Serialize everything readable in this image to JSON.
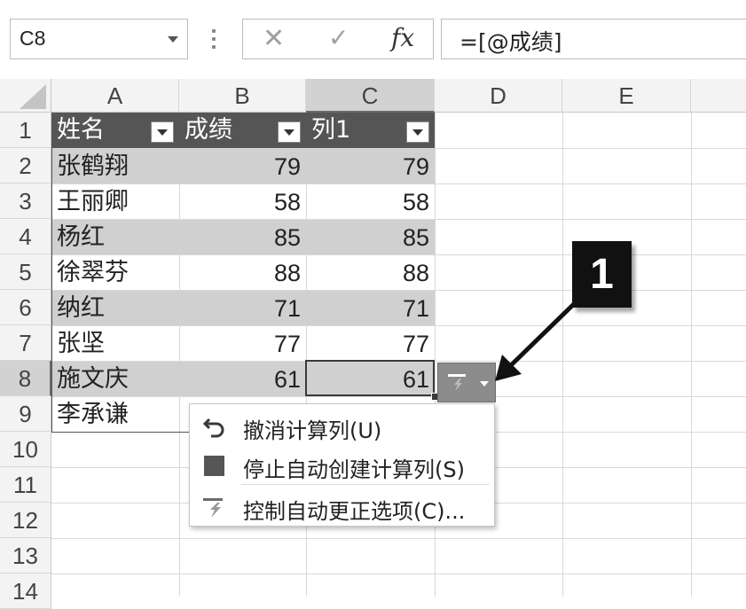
{
  "formula_bar": {
    "name_box": "C8",
    "cancel_symbol": "✕",
    "enter_symbol": "✓",
    "fx_label": "fx",
    "formula": "=[@成绩]"
  },
  "columns": [
    "A",
    "B",
    "C",
    "D",
    "E"
  ],
  "rows": [
    "1",
    "2",
    "3",
    "4",
    "5",
    "6",
    "7",
    "8",
    "9",
    "10",
    "11",
    "12",
    "13",
    "14"
  ],
  "table": {
    "headers": [
      "姓名",
      "成绩",
      "列1"
    ],
    "data": [
      [
        "张鹤翔",
        "79",
        "79"
      ],
      [
        "王丽卿",
        "58",
        "58"
      ],
      [
        "杨红",
        "85",
        "85"
      ],
      [
        "徐翠芬",
        "88",
        "88"
      ],
      [
        "纳红",
        "71",
        "71"
      ],
      [
        "张坚",
        "77",
        "77"
      ],
      [
        "施文庆",
        "61",
        "61"
      ],
      [
        "李承谦",
        "",
        ""
      ]
    ]
  },
  "autocorrect_menu": {
    "items": [
      {
        "label": "撤消计算列(U)",
        "icon": "undo-icon"
      },
      {
        "label": "停止自动创建计算列(S)",
        "icon": "stop-square-icon"
      },
      {
        "label": "控制自动更正选项(C)...",
        "icon": "autocorrect-lightning-icon"
      }
    ]
  },
  "callout": {
    "label": "1"
  },
  "colors": {
    "table_header_bg": "#555555",
    "band_bg": "#d0d0d0",
    "selected_header_bg": "#d2d2d2",
    "callout_bg": "#111111"
  }
}
